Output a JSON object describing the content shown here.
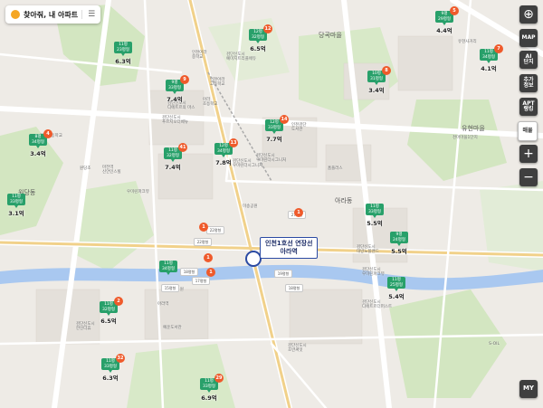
{
  "topbar": {
    "title": "찾아줘, 내 아파트",
    "menu_icon": "sliders-icon"
  },
  "controls": [
    {
      "key": "location",
      "label": "",
      "icon": "locate-icon"
    },
    {
      "key": "map",
      "label": "MAP"
    },
    {
      "key": "ai",
      "label": "AI\n단지"
    },
    {
      "key": "info",
      "label": "추가\n정보"
    },
    {
      "key": "apt",
      "label": "APT\n랭킹"
    },
    {
      "key": "sale",
      "label": "매물"
    },
    {
      "key": "zoom_in",
      "label": "+"
    },
    {
      "key": "zoom_out",
      "label": "−"
    },
    {
      "key": "my",
      "label": "MY"
    }
  ],
  "station_callout": {
    "line1": "인천1호선 연장선",
    "line2": "아라역"
  },
  "area_labels": [
    "당곡마을",
    "원당동",
    "아라동",
    "유현마을"
  ],
  "markers": [
    {
      "top": "11평",
      "mid": "23평형",
      "price": "6.3억",
      "badge": ""
    },
    {
      "top": "12평",
      "mid": "32평형",
      "price": "6.5억",
      "badge": "12"
    },
    {
      "top": "9평",
      "mid": "33평형",
      "price": "7.4억",
      "badge": "9"
    },
    {
      "top": "12평",
      "mid": "33평형",
      "price": "7.7억",
      "badge": "14"
    },
    {
      "top": "11평",
      "mid": "32평형",
      "price": "7.4억",
      "badge": "41"
    },
    {
      "top": "12평",
      "mid": "34평형",
      "price": "7.8억",
      "badge": "13"
    },
    {
      "top": "9평",
      "mid": "29평형",
      "price": "4.4억",
      "badge": "5"
    },
    {
      "top": "11평",
      "mid": "34평형",
      "price": "4.1억",
      "badge": "7"
    },
    {
      "top": "10평",
      "mid": "31평형",
      "price": "3.4억",
      "badge": "8"
    },
    {
      "top": "8평",
      "mid": "34평형",
      "price": "3.4억",
      "badge": "4"
    },
    {
      "top": "11평",
      "mid": "33평형",
      "price": "3.1억",
      "badge": ""
    },
    {
      "top": "11평",
      "mid": "33평형",
      "price": "5.5억",
      "badge": ""
    },
    {
      "top": "9평",
      "mid": "24평형",
      "price": "5.5억",
      "badge": ""
    },
    {
      "top": "11평",
      "mid": "34평형",
      "price": "",
      "badge": ""
    },
    {
      "top": "11평",
      "mid": "25평형",
      "price": "5.4억",
      "badge": ""
    },
    {
      "top": "11평",
      "mid": "32평형",
      "price": "6.5억",
      "badge": "2"
    },
    {
      "top": "11평",
      "mid": "33평형",
      "price": "6.3억",
      "badge": "32"
    },
    {
      "top": "11평",
      "mid": "33평형",
      "price": "6.9억",
      "badge": "29"
    }
  ],
  "white_markers": [
    {
      "label": "27평형"
    },
    {
      "label": "22평형"
    },
    {
      "label": "18평형"
    },
    {
      "label": "17평형"
    },
    {
      "label": "22평형"
    },
    {
      "label": "19평형"
    },
    {
      "label": "18평형"
    },
    {
      "label": "15평형"
    }
  ],
  "orange_badges": [
    "1",
    "1",
    "1",
    "1"
  ],
  "place_labels": [
    "검단신도시\n디에트르의 마스",
    "검단신도시\n우미린더시그니처",
    "인천아라\n중학교",
    "인천아라\n고등학교",
    "검단신도시\n푸르지오더베뉴",
    "아라\n초등학교",
    "인천검단\n도서관",
    "원당고등학교",
    "검단신도시\n예미지트리플에듀",
    "검단신도시\n우미린더시그니처",
    "마전역\n신안인스빌",
    "천마마을1단지",
    "미송공원",
    "검단신도시\n디에트르더퍼스트",
    "검단신도시\n우미린파크뷰",
    "검단신도시\n대방노블랜드",
    "S-OIL",
    "아라근린공원",
    "예운도서관",
    "검단신도시\n한신더휴",
    "원당초",
    "홈플러스",
    "우미린파크뷰",
    "아라역",
    "검단신도시\n호반써밋",
    "유현사거리"
  ]
}
